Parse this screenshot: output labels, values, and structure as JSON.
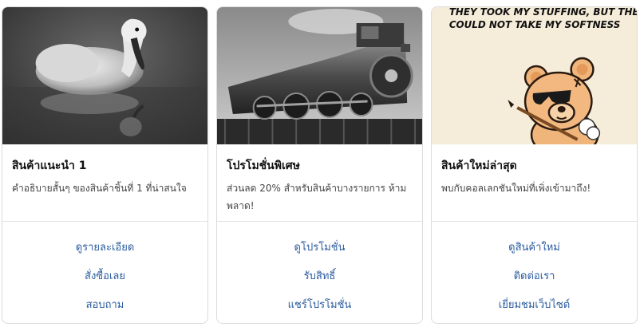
{
  "cards": [
    {
      "image_alt": "duckling",
      "title": "สินค้าแนะนำ 1",
      "text": "คำอธิบายสั้นๆ ของสินค้าชิ้นที่ 1 ที่น่าสนใจ",
      "links": [
        "ดูรายละเอียด",
        "สั่งซื้อเลย",
        "สอบถาม"
      ]
    },
    {
      "image_alt": "locomotive",
      "title": "โปรโมชั่นพิเศษ",
      "text": "ส่วนลด 20% สำหรับสินค้าบางรายการ ห้ามพลาด!",
      "links": [
        "ดูโปรโมชั่น",
        "รับสิทธิ์",
        "แชร์โปรโมชั่น"
      ]
    },
    {
      "image_alt": "teddy bear",
      "image_caption_line1": "THEY TOOK MY STUFFING, BUT THEY",
      "image_caption_line2": "COULD NOT TAKE MY SOFTNESS",
      "title": "สินค้าใหม่ล่าสุด",
      "text": "พบกับคอลเลกชันใหม่ที่เพิ่งเข้ามาถึง!",
      "links": [
        "ดูสินค้าใหม่",
        "ติดต่อเรา",
        "เยี่ยมชมเว็บไซต์"
      ]
    }
  ],
  "colors": {
    "link": "#2b5c9e",
    "title": "#111111",
    "text": "#444444",
    "border": "#dcdcdc"
  }
}
